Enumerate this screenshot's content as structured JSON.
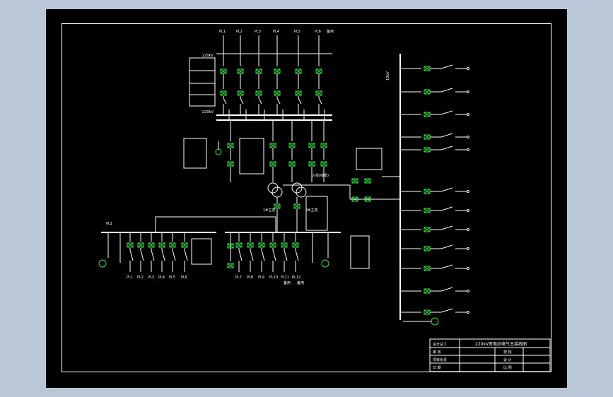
{
  "colors": {
    "background": "#b9c7d6",
    "sheet": "#000000",
    "lines": "#ffffff",
    "breakers": "#27e73a"
  },
  "top_feeders": [
    "PL1",
    "PL2",
    "PL3",
    "PL4",
    "PL5",
    "PL6"
  ],
  "top_spare_label": "备用",
  "top_bus_label": "220kV",
  "right_bus_label": "10kV",
  "bottom_left_feeders": [
    "PL1",
    "PL2",
    "PL3",
    "PL4",
    "PL5",
    "PL6"
  ],
  "bottom_right_feeders": [
    "PL7",
    "PL8",
    "PL9",
    "PL10",
    "PL11",
    "PL12"
  ],
  "bottom_spare_labels": [
    "备用",
    "备用"
  ],
  "incoming_line_label": "入线(线缆)",
  "transformer_labels": [
    "1#主变",
    "2#主变"
  ],
  "left_bus_label": "PL1",
  "title_block": {
    "title": "220kV变电站电气主接线图",
    "rows": [
      {
        "left": "设计总工",
        "right": ""
      },
      {
        "left": "审  核",
        "right": "校 核"
      },
      {
        "left": "项目负责",
        "right": "设 计"
      },
      {
        "left": "日  期",
        "right": "比 例"
      }
    ]
  }
}
